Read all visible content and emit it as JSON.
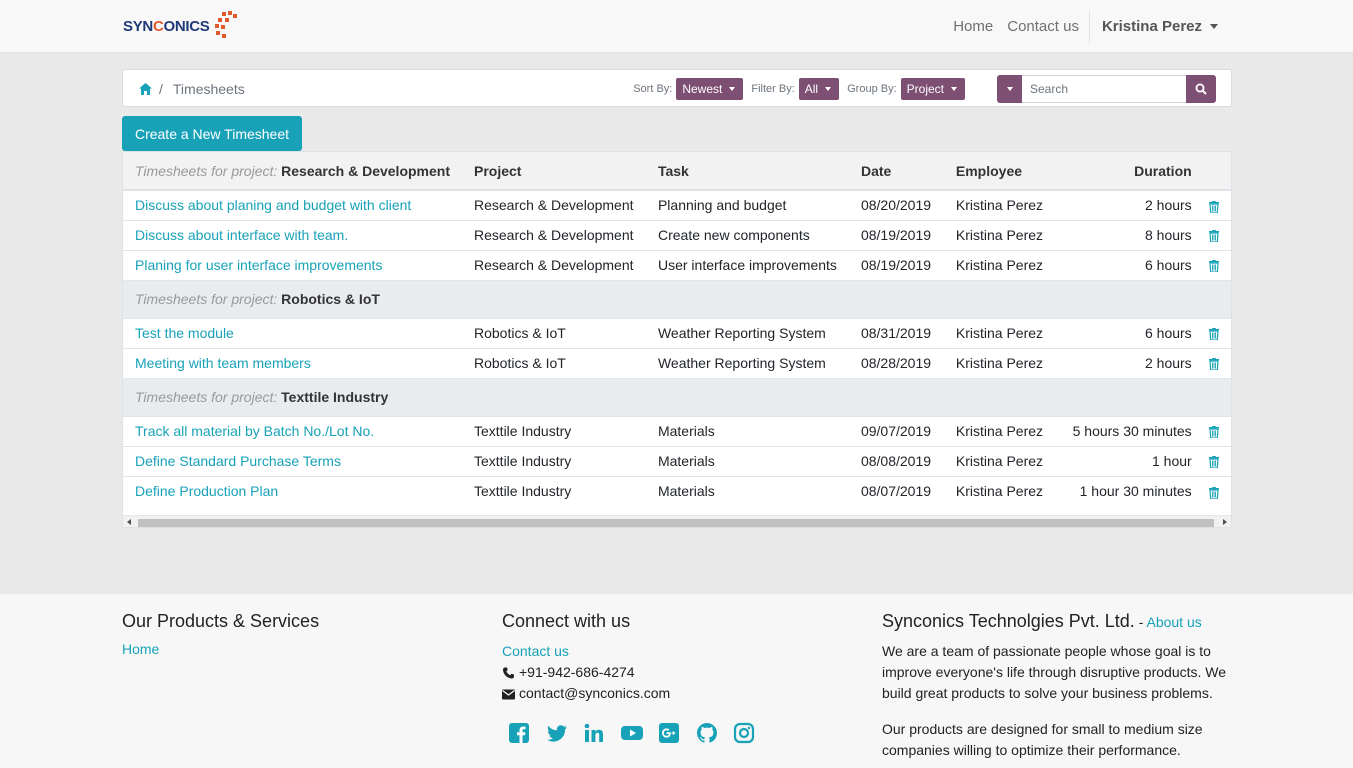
{
  "brand": {
    "logo_text_a": "SYN",
    "logo_text_b": "C",
    "logo_text_c": "ONICS"
  },
  "nav": {
    "home": "Home",
    "contact": "Contact us",
    "user": "Kristina Perez"
  },
  "breadcrumb": {
    "current": "Timesheets"
  },
  "filters": {
    "sort_label": "Sort By:",
    "sort_value": "Newest",
    "filter_label": "Filter By:",
    "filter_value": "All",
    "group_label": "Group By:",
    "group_value": "Project"
  },
  "search": {
    "placeholder": "Search"
  },
  "create_button": "Create a New Timesheet",
  "table": {
    "headers": {
      "group_prefix": "Timesheets for project:",
      "project": "Project",
      "task": "Task",
      "date": "Date",
      "employee": "Employee",
      "duration": "Duration"
    },
    "groups": [
      {
        "prefix": "Timesheets for project:",
        "name": "Research & Development",
        "rows": [
          {
            "title": "Discuss about planing and budget with client",
            "project": "Research & Development",
            "task": "Planning and budget",
            "date": "08/20/2019",
            "employee": "Kristina Perez",
            "duration": "2 hours"
          },
          {
            "title": "Discuss about interface with team.",
            "project": "Research & Development",
            "task": "Create new components",
            "date": "08/19/2019",
            "employee": "Kristina Perez",
            "duration": "8 hours"
          },
          {
            "title": "Planing for user interface improvements",
            "project": "Research & Development",
            "task": "User interface improvements",
            "date": "08/19/2019",
            "employee": "Kristina Perez",
            "duration": "6 hours"
          }
        ]
      },
      {
        "prefix": "Timesheets for project:",
        "name": "Robotics & IoT",
        "rows": [
          {
            "title": "Test the module",
            "project": "Robotics & IoT",
            "task": "Weather Reporting System",
            "date": "08/31/2019",
            "employee": "Kristina Perez",
            "duration": "6 hours"
          },
          {
            "title": "Meeting with team members",
            "project": "Robotics & IoT",
            "task": "Weather Reporting System",
            "date": "08/28/2019",
            "employee": "Kristina Perez",
            "duration": "2 hours"
          }
        ]
      },
      {
        "prefix": "Timesheets for project:",
        "name": "Texttile Industry",
        "rows": [
          {
            "title": "Track all material by Batch No./Lot No.",
            "project": "Texttile Industry",
            "task": "Materials",
            "date": "09/07/2019",
            "employee": "Kristina Perez",
            "duration": "5 hours 30 minutes"
          },
          {
            "title": "Define Standard Purchase Terms",
            "project": "Texttile Industry",
            "task": "Materials",
            "date": "08/08/2019",
            "employee": "Kristina Perez",
            "duration": "1 hour"
          },
          {
            "title": "Define Production Plan",
            "project": "Texttile Industry",
            "task": "Materials",
            "date": "08/07/2019",
            "employee": "Kristina Perez",
            "duration": "1 hour 30 minutes"
          }
        ]
      }
    ]
  },
  "footer": {
    "products_title": "Our Products & Services",
    "products_home": "Home",
    "connect_title": "Connect with us",
    "connect_contact": "Contact us",
    "phone": "+91-942-686-4274",
    "email": "contact@synconics.com",
    "company_title": "Synconics Technolgies Pvt. Ltd.",
    "company_dash": " - ",
    "about_link": "About us",
    "about_p1": "We are a team of passionate people whose goal is to improve everyone's life through disruptive products. We build great products to solve your business problems.",
    "about_p2": "Our products are designed for small to medium size companies willing to optimize their performance."
  },
  "colors": {
    "accent": "#17a2b8",
    "filter_btn": "#7c4f73",
    "brand_blue": "#1f3a78",
    "brand_orange": "#e25a2a"
  },
  "icons": [
    "home-icon",
    "search-icon",
    "trash-icon",
    "phone-icon",
    "envelope-icon",
    "facebook-icon",
    "twitter-icon",
    "linkedin-icon",
    "youtube-icon",
    "google-plus-icon",
    "github-icon",
    "instagram-icon"
  ]
}
